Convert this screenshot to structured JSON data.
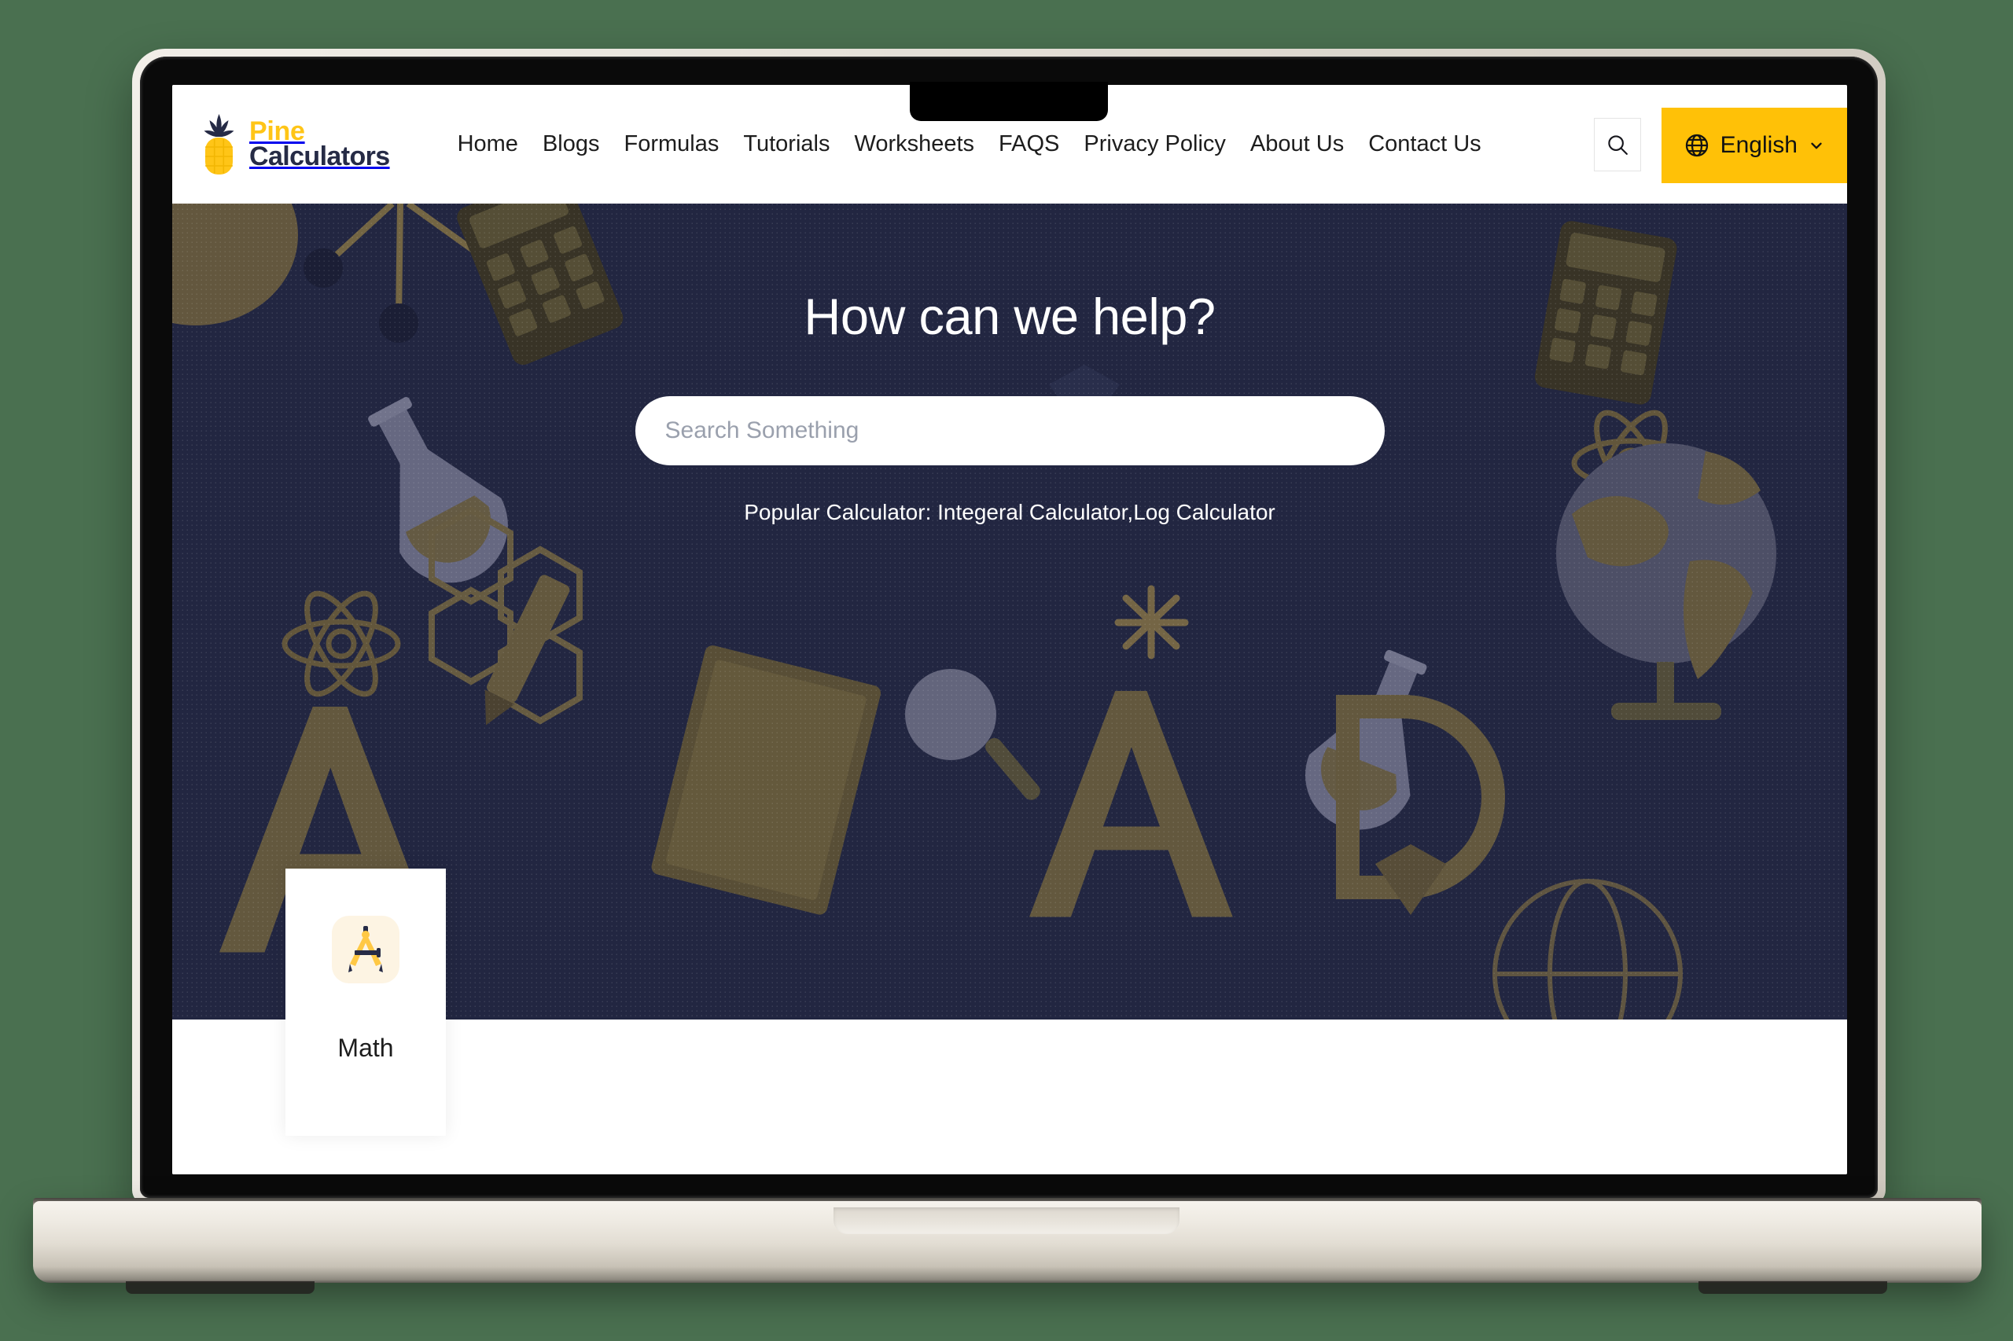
{
  "colors": {
    "page_background": "#4a7050",
    "brand_yellow": "#ffc107",
    "logo_yellow": "#ffc517",
    "navy": "#222641",
    "logo_navy": "#262b46",
    "laptop_body": "#eeeae2"
  },
  "device": {
    "type": "laptop-mockup",
    "has_camera_notch": true
  },
  "header": {
    "logo": {
      "icon": "pineapple-icon",
      "text_top": "Pine",
      "text_bottom": "Calculators"
    },
    "nav_items": [
      {
        "label": "Home"
      },
      {
        "label": "Blogs"
      },
      {
        "label": "Formulas"
      },
      {
        "label": "Tutorials"
      },
      {
        "label": "Worksheets"
      },
      {
        "label": "FAQS"
      },
      {
        "label": "Privacy Policy"
      },
      {
        "label": "About Us"
      },
      {
        "label": "Contact Us"
      }
    ],
    "search_toggle_icon": "search-icon",
    "language": {
      "icon": "globe-icon",
      "label": "English",
      "chevron": "chevron-down-icon"
    }
  },
  "hero": {
    "heading": "How can we help?",
    "search_placeholder": "Search Something",
    "search_value": "",
    "popular_prefix": "Popular Calculator:",
    "popular_links": [
      {
        "label": "Integeral Calculator"
      },
      {
        "label": "Log Calculator"
      }
    ],
    "popular_separator": ",",
    "background_motifs": [
      "flask",
      "calculator",
      "molecule",
      "globe",
      "compass",
      "hexagon-chain",
      "letter-a",
      "book",
      "magnifier",
      "pencil",
      "atom"
    ]
  },
  "categories": [
    {
      "label": "Math",
      "icon": "compass-divider-icon"
    }
  ]
}
